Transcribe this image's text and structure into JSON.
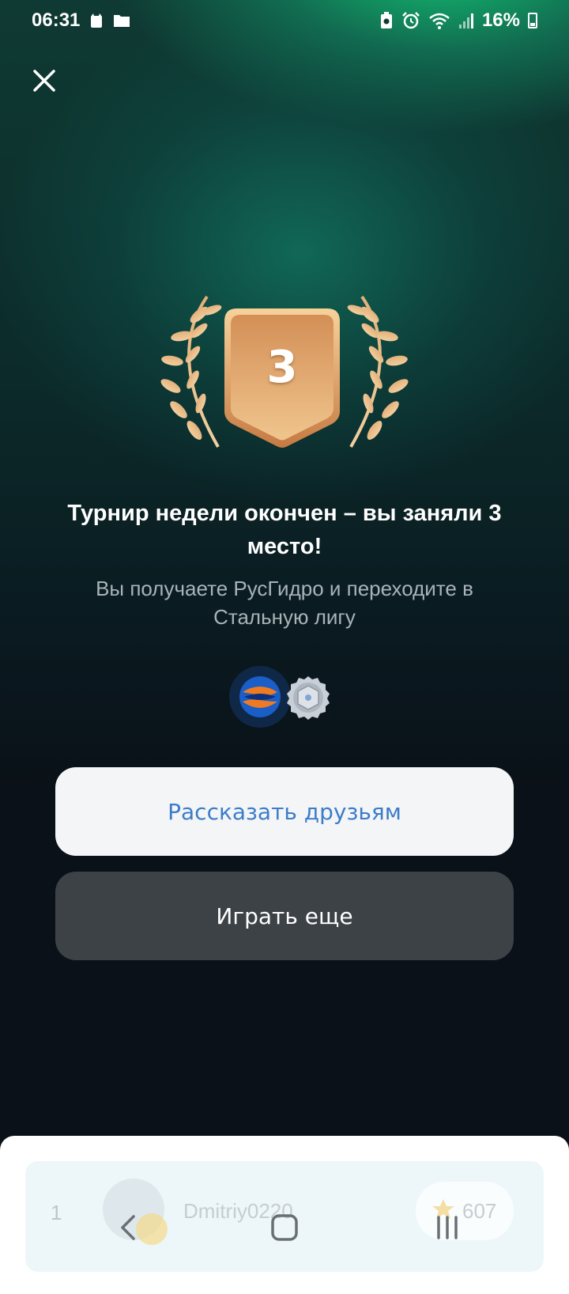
{
  "status_bar": {
    "time": "06:31",
    "battery": "16%",
    "icons": [
      "notification-app-icon",
      "folder-icon",
      "battery-saver-icon",
      "alarm-icon",
      "wifi-icon",
      "signal-icon",
      "battery-icon"
    ]
  },
  "header": {
    "close_icon": "close-icon"
  },
  "result": {
    "rank": "3",
    "title": "Турнир недели окончен – вы заняли 3 место!",
    "subtitle": "Вы получаете РусГидро и переходите в Стальную лигу"
  },
  "rewards": {
    "company_icon": "rushydro-logo-icon",
    "league_icon": "steel-league-icon"
  },
  "actions": {
    "share_label": "Рассказать друзьям",
    "play_label": "Играть еще"
  },
  "leaderboard": {
    "rows": [
      {
        "rank": "1",
        "name": "Dmitriy0220",
        "score": "607"
      }
    ]
  },
  "nav": {
    "back_icon": "back-icon",
    "home_icon": "home-icon",
    "recents_icon": "recents-icon"
  },
  "colors": {
    "accent_green": "#14c878",
    "share_text": "#3d7cc9",
    "bronze": "#d99a5f"
  }
}
